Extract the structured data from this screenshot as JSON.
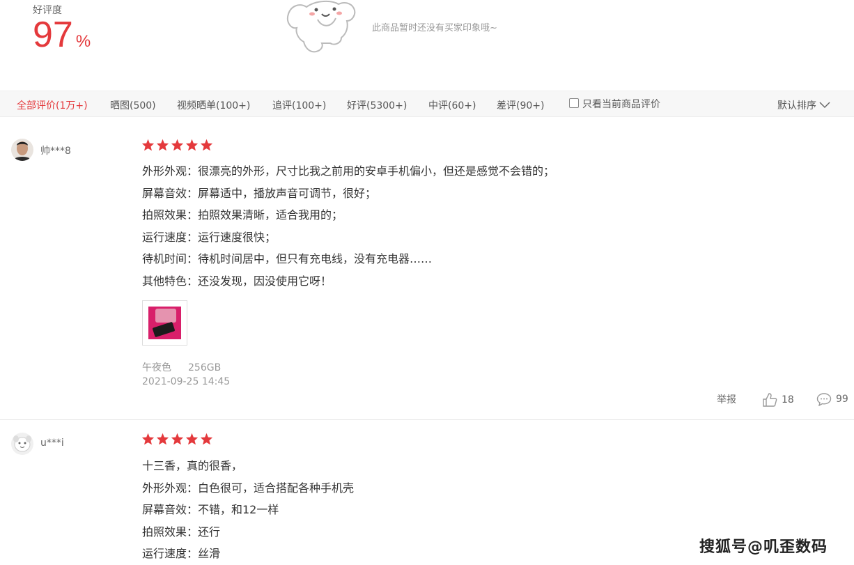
{
  "summary": {
    "rating_label": "好评度",
    "rating_value": "97",
    "rating_unit": "%",
    "no_impression_text": "此商品暂时还没有买家印象哦~"
  },
  "filter_bar": {
    "tabs": [
      {
        "label": "全部评价(1万+)",
        "active": true
      },
      {
        "label": "晒图(500)",
        "active": false
      },
      {
        "label": "视频晒单(100+)",
        "active": false
      },
      {
        "label": "追评(100+)",
        "active": false
      },
      {
        "label": "好评(5300+)",
        "active": false
      },
      {
        "label": "中评(60+)",
        "active": false
      },
      {
        "label": "差评(90+)",
        "active": false
      }
    ],
    "only_current_label": "只看当前商品评价",
    "only_current_checked": false,
    "sort_label": "默认排序"
  },
  "reviews": [
    {
      "username": "帅***8",
      "stars": 5,
      "lines": [
        "外形外观：很漂亮的外形，尺寸比我之前用的安卓手机偏小，但还是感觉不会错的；",
        "屏幕音效：屏幕适中，播放声音可调节，很好；",
        "拍照效果：拍照效果清晰，适合我用的；",
        "运行速度：运行速度很快；",
        "待机时间：待机时间居中，但只有充电线，没有充电器……",
        "其他特色：还没发现，因没使用它呀！"
      ],
      "color": "午夜色",
      "storage": "256GB",
      "date": "2021-09-25 14:45",
      "report_label": "举报",
      "likes": "18",
      "replies": "99"
    },
    {
      "username": "u***i",
      "stars": 5,
      "lines": [
        "十三香，真的很香，",
        "外形外观：白色很可，适合搭配各种手机壳",
        "屏幕音效：不错，和12一样",
        "拍照效果：还行",
        "运行速度：丝滑"
      ]
    }
  ],
  "watermark": "搜狐号@叽歪数码",
  "colors": {
    "accent": "#e4393c",
    "muted": "#999999",
    "filter_bg": "#f7f7f7"
  }
}
